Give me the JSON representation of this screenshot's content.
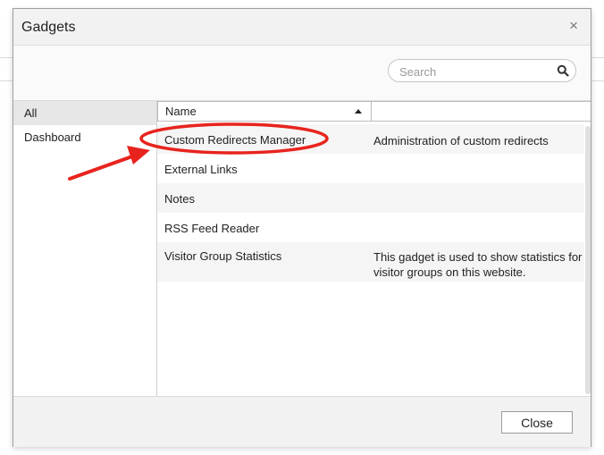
{
  "dialog": {
    "title": "Gadgets",
    "close_glyph": "×"
  },
  "search": {
    "placeholder": "Search",
    "value": "",
    "icon": "search-icon"
  },
  "sidebar": {
    "items": [
      {
        "label": "All",
        "selected": true
      },
      {
        "label": "Dashboard",
        "selected": false
      }
    ]
  },
  "grid": {
    "columns": [
      {
        "label": "Name",
        "sort": "ascending"
      },
      {
        "label": ""
      }
    ],
    "rows": [
      {
        "name": "Custom Redirects Manager",
        "description": "Administration of custom redirects"
      },
      {
        "name": "External Links",
        "description": ""
      },
      {
        "name": "Notes",
        "description": ""
      },
      {
        "name": "RSS Feed Reader",
        "description": ""
      },
      {
        "name": "Visitor Group Statistics",
        "description": "This gadget is used to show statistics for visitor groups on this website."
      }
    ]
  },
  "footer": {
    "close_label": "Close"
  },
  "annotation": {
    "color": "#e8231d"
  }
}
